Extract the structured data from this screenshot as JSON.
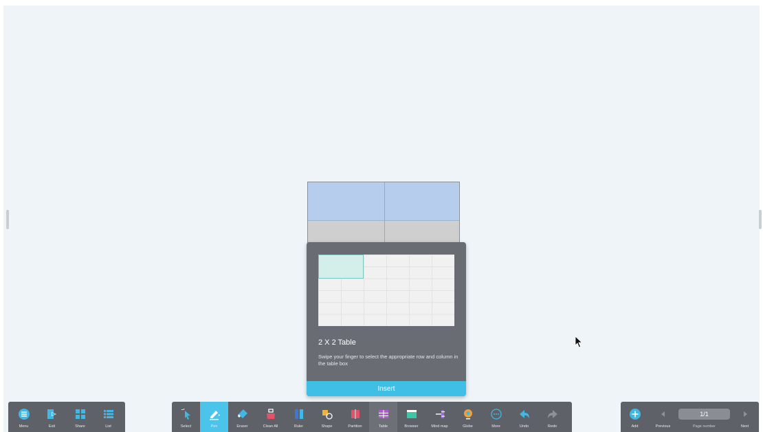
{
  "table_popup": {
    "title": "2 X 2 Table",
    "hint": "Swipe your finger to select the appropriate row and column in the table box",
    "insert_label": "Insert"
  },
  "left_toolbar": {
    "items": [
      {
        "label": "Menu",
        "icon": "menu-icon"
      },
      {
        "label": "Exit",
        "icon": "exit-icon"
      },
      {
        "label": "Share",
        "icon": "share-icon"
      },
      {
        "label": "List",
        "icon": "list-icon"
      }
    ]
  },
  "center_toolbar": {
    "active": "Pen",
    "highlighted": "Table",
    "items": [
      {
        "label": "Select",
        "icon": "select-icon"
      },
      {
        "label": "Pen",
        "icon": "pen-icon"
      },
      {
        "label": "Eraser",
        "icon": "eraser-icon"
      },
      {
        "label": "Clean All",
        "icon": "clean-all-icon"
      },
      {
        "label": "Ruler",
        "icon": "ruler-icon"
      },
      {
        "label": "Shape",
        "icon": "shape-icon"
      },
      {
        "label": "Partition",
        "icon": "partition-icon"
      },
      {
        "label": "Table",
        "icon": "table-icon"
      },
      {
        "label": "Browser",
        "icon": "browser-icon"
      },
      {
        "label": "Mind map",
        "icon": "mind-map-icon"
      },
      {
        "label": "Globe",
        "icon": "globe-icon"
      },
      {
        "label": "More",
        "icon": "more-icon"
      },
      {
        "label": "Undo",
        "icon": "undo-icon"
      },
      {
        "label": "Redo",
        "icon": "redo-icon"
      }
    ]
  },
  "right_toolbar": {
    "add_label": "Add",
    "previous_label": "Previous",
    "page_number": "1/1",
    "page_number_label": "Page number",
    "next_label": "Next"
  },
  "colors": {
    "canvas": "#eef4f8",
    "toolbar": "#5f6168",
    "accent": "#4cc3e8",
    "insert": "#3fbfe6"
  }
}
